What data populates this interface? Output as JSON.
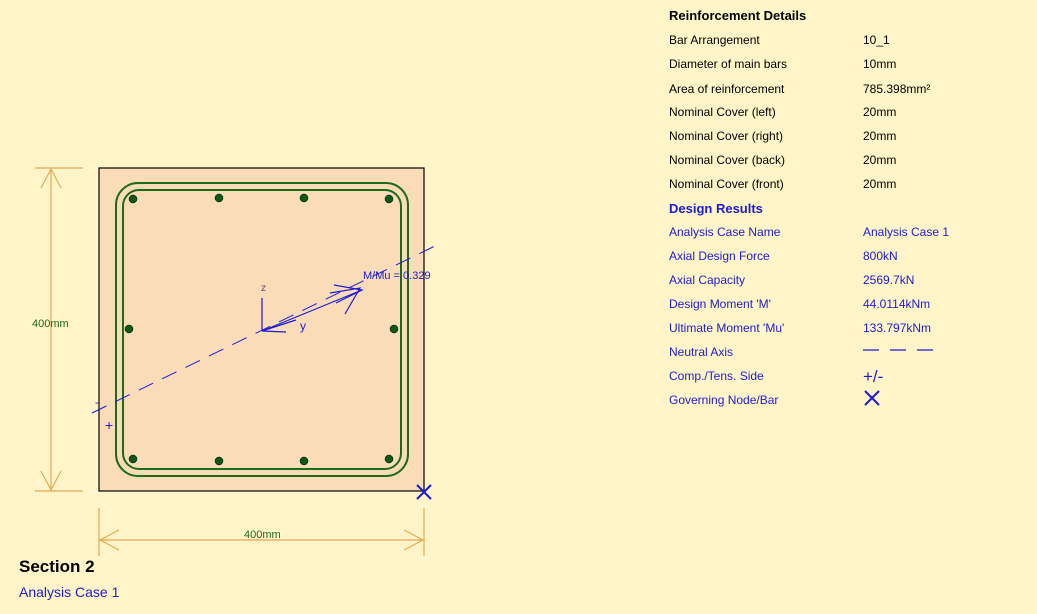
{
  "reinforcement": {
    "heading": "Reinforcement Details",
    "rows": [
      {
        "label": "Bar Arrangement",
        "value": "10_1"
      },
      {
        "label": "Diameter of main bars",
        "value": "10mm"
      },
      {
        "label": "Area of reinforcement",
        "value": "785.398mm²"
      },
      {
        "label": "Nominal Cover (left)",
        "value": "20mm"
      },
      {
        "label": "Nominal Cover (right)",
        "value": "20mm"
      },
      {
        "label": "Nominal Cover (back)",
        "value": "20mm"
      },
      {
        "label": "Nominal Cover (front)",
        "value": "20mm"
      }
    ]
  },
  "design_results": {
    "heading": "Design Results",
    "rows": [
      {
        "label": "Analysis Case Name",
        "value": "Analysis Case 1"
      },
      {
        "label": "Axial Design Force",
        "value": "800kN"
      },
      {
        "label": "Axial Capacity",
        "value": "2569.7kN"
      },
      {
        "label": "Design Moment 'M'",
        "value": "44.0114kNm"
      },
      {
        "label": "Ultimate Moment 'Mu'",
        "value": "133.797kNm"
      },
      {
        "label": "Neutral Axis",
        "value": ""
      },
      {
        "label": "Comp./Tens. Side",
        "value": "+/-"
      },
      {
        "label": "Governing Node/Bar",
        "value": ""
      }
    ]
  },
  "section": {
    "height_dim": "400mm",
    "width_dim": "400mm",
    "ratio_label": "M/Mu = 0.329",
    "axis_z": "z",
    "axis_y": "y",
    "comp_marker": "+",
    "tens_marker": "-"
  },
  "footer": {
    "title": "Section 2",
    "subtitle": "Analysis Case 1"
  },
  "colors": {
    "background": "#fff5c8",
    "concrete": "#fadcb8",
    "dimension": "#e8a854",
    "link": "#1b6b1b",
    "bar": "#0b5a14",
    "analysis_blue": "#1c1cd4"
  }
}
